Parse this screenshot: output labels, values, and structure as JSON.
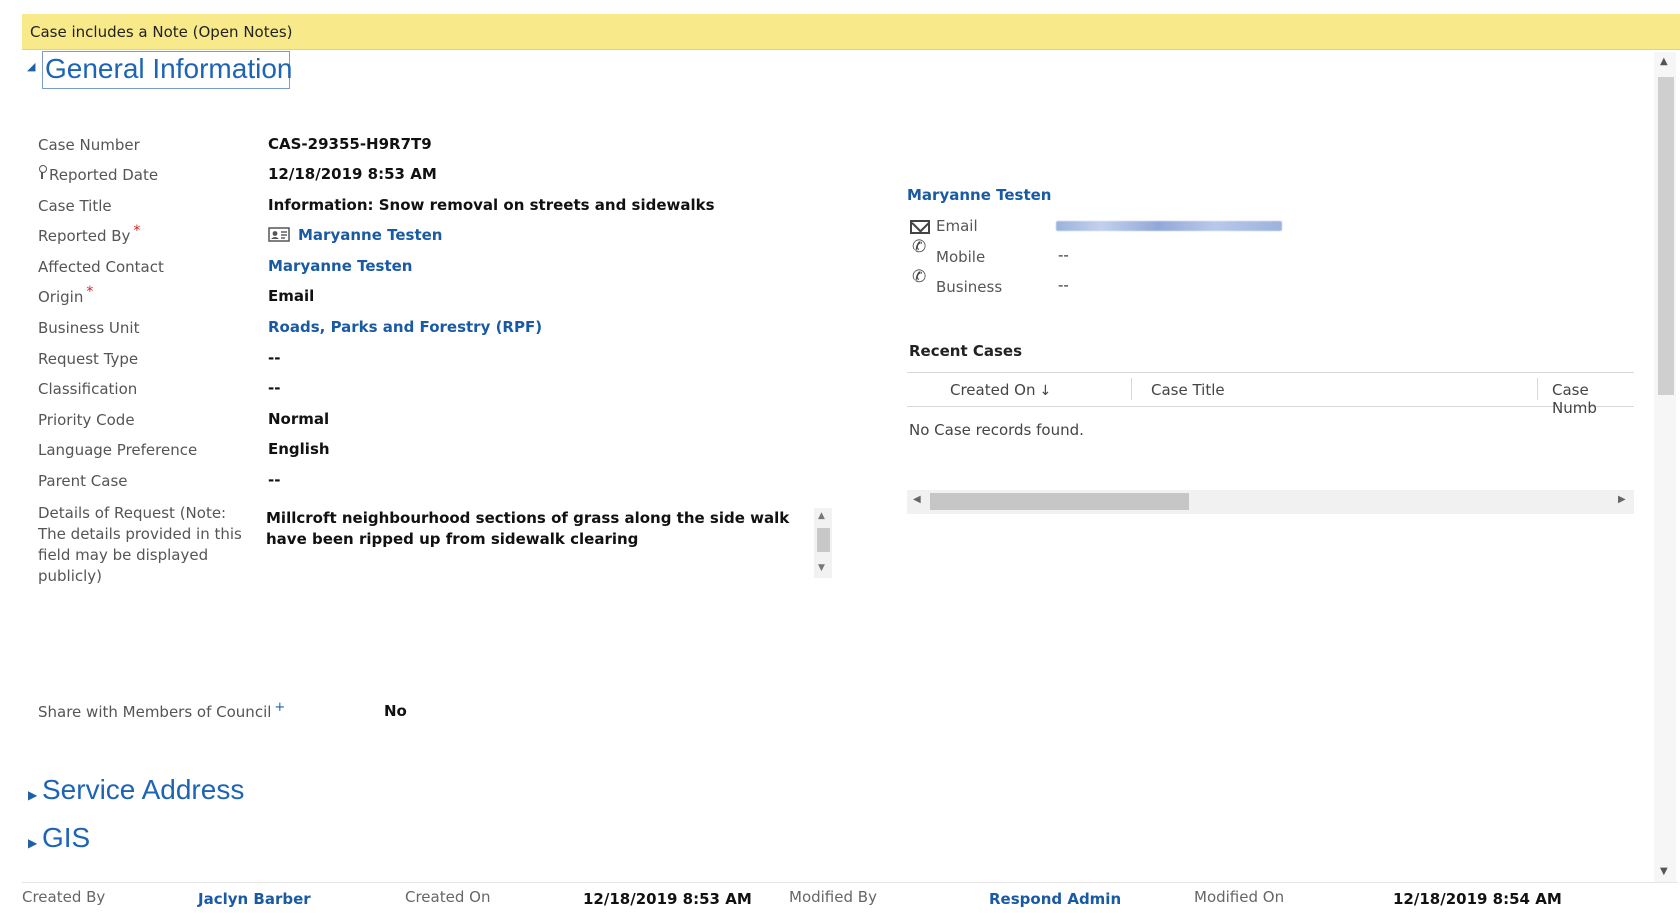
{
  "notice": {
    "text": "Case includes a Note (Open Notes)"
  },
  "sections": {
    "general": "General Information",
    "service_address": "Service Address",
    "gis": "GIS"
  },
  "fields": {
    "case_number": {
      "label": "Case Number",
      "value": "CAS-29355-H9R7T9"
    },
    "reported_date": {
      "label": "Reported Date",
      "value": "12/18/2019   8:53 AM"
    },
    "case_title": {
      "label": "Case Title",
      "value": "Information: Snow removal on streets and sidewalks"
    },
    "reported_by": {
      "label": "Reported By",
      "value": "Maryanne Testen"
    },
    "affected_contact": {
      "label": "Affected Contact",
      "value": "Maryanne Testen"
    },
    "origin": {
      "label": "Origin",
      "value": "Email"
    },
    "business_unit": {
      "label": "Business Unit",
      "value": "Roads, Parks and Forestry (RPF)"
    },
    "request_type": {
      "label": "Request Type",
      "value": "--"
    },
    "classification": {
      "label": "Classification",
      "value": "--"
    },
    "priority_code": {
      "label": "Priority Code",
      "value": "Normal"
    },
    "language_preference": {
      "label": "Language Preference",
      "value": "English"
    },
    "parent_case": {
      "label": "Parent Case",
      "value": "--"
    },
    "details": {
      "label_lines": [
        "Details of Request (Note:",
        "The details provided in this",
        "field may be displayed",
        "publicly)"
      ],
      "value": "Millcroft neighbourhood sections of grass along the side walk have been ripped up from sidewalk clearing"
    },
    "share_council": {
      "label": "Share with Members of Council",
      "value": "No"
    }
  },
  "required_marker": "*",
  "recommended_marker": "+",
  "contact_card": {
    "name": "Maryanne Testen",
    "email_label": "Email",
    "mobile_label": "Mobile",
    "mobile_value": "--",
    "business_label": "Business",
    "business_value": "--"
  },
  "recent_cases": {
    "title": "Recent Cases",
    "columns": [
      "Created On",
      "Case Title",
      "Case Numb"
    ],
    "sort_icon": "↓",
    "empty_message": "No Case records found."
  },
  "footer": {
    "created_by_label": "Created By",
    "created_by_value": "Jaclyn Barber",
    "created_on_label": "Created On",
    "created_on_value": "12/18/2019   8:53 AM",
    "modified_by_label": "Modified By",
    "modified_by_value": "Respond Admin",
    "modified_on_label": "Modified On",
    "modified_on_value": "12/18/2019   8:54 AM"
  },
  "icons": {
    "expanded": "◢",
    "collapsed": "▶",
    "phone": "✆",
    "scroll_up": "▲",
    "scroll_down": "▼",
    "scroll_left": "◀",
    "scroll_right": "▶"
  },
  "colors": {
    "link": "#1a5aa3",
    "notice_bg": "#f8e98b",
    "required": "#d42020"
  }
}
